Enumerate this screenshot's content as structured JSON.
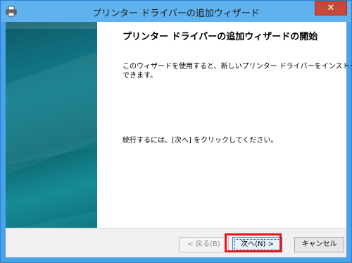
{
  "window": {
    "title": "プリンター ドライバーの追加ウィザード",
    "close_label": "✕",
    "app_icon": "printer-icon"
  },
  "wizard": {
    "heading": "プリンター ドライバーの追加ウィザードの開始",
    "description_line1": "このウィザードを使用すると、新しいプリンター ドライバーをインストール",
    "description_line2": "できます。",
    "continue_text": "続行するには、[次へ] をクリックしてください。"
  },
  "buttons": {
    "back_label": "< 戻る(B)",
    "next_label": "次へ(N) >",
    "cancel_label": "キャンセル"
  },
  "colors": {
    "highlight": "#e8141c",
    "close_button": "#c7473a",
    "banner": "#137f8c"
  }
}
